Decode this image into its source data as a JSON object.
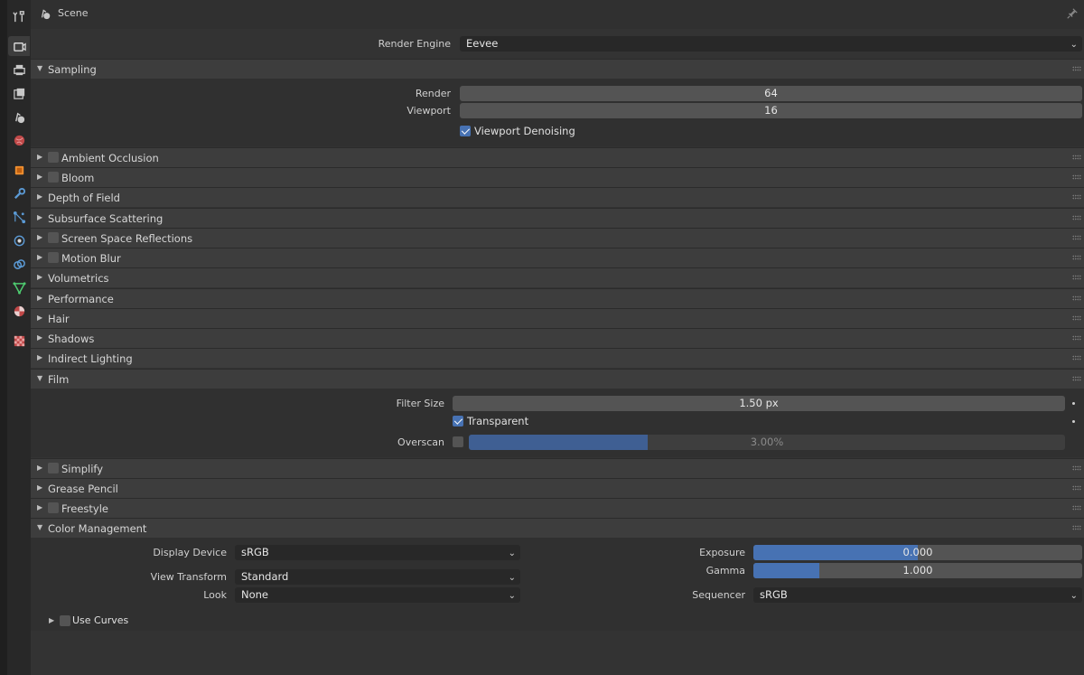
{
  "header": {
    "title": "Scene"
  },
  "tabs": [
    {
      "icon": "tool-icon",
      "color": "#c8c8c8"
    },
    {
      "icon": "render-icon",
      "color": "#c8c8c8",
      "active": true
    },
    {
      "icon": "output-icon",
      "color": "#c8c8c8"
    },
    {
      "icon": "view-layer-icon",
      "color": "#c8c8c8"
    },
    {
      "icon": "scene-icon",
      "color": "#c8c8c8"
    },
    {
      "icon": "world-icon",
      "color": "#e06060"
    },
    {
      "icon": "object-icon",
      "color": "#f09030"
    },
    {
      "icon": "modifier-icon",
      "color": "#5b9ad5"
    },
    {
      "icon": "particles-icon",
      "color": "#5b9ad5"
    },
    {
      "icon": "physics-icon",
      "color": "#5b9ad5"
    },
    {
      "icon": "constraints-icon",
      "color": "#5b9ad5"
    },
    {
      "icon": "data-icon",
      "color": "#4ecb70"
    },
    {
      "icon": "material-icon",
      "color": "#e06060"
    },
    {
      "icon": "texture-icon",
      "color": "#e06060"
    }
  ],
  "render_engine": {
    "label": "Render Engine",
    "value": "Eevee"
  },
  "sampling": {
    "title": "Sampling",
    "render_label": "Render",
    "render_value": "64",
    "viewport_label": "Viewport",
    "viewport_value": "16",
    "denoise_label": "Viewport Denoising"
  },
  "panels": {
    "ambient_occlusion": "Ambient Occlusion",
    "bloom": "Bloom",
    "depth_of_field": "Depth of Field",
    "subsurface": "Subsurface Scattering",
    "ssr": "Screen Space Reflections",
    "motion_blur": "Motion Blur",
    "volumetrics": "Volumetrics",
    "performance": "Performance",
    "hair": "Hair",
    "shadows": "Shadows",
    "indirect": "Indirect Lighting",
    "film": "Film",
    "simplify": "Simplify",
    "grease_pencil": "Grease Pencil",
    "freestyle": "Freestyle",
    "color_management": "Color Management"
  },
  "film": {
    "filter_label": "Filter Size",
    "filter_value": "1.50 px",
    "transparent_label": "Transparent",
    "overscan_label": "Overscan",
    "overscan_value": "3.00%",
    "overscan_fraction": 0.3
  },
  "color_management": {
    "display_device_label": "Display Device",
    "display_device_value": "sRGB",
    "view_transform_label": "View Transform",
    "view_transform_value": "Standard",
    "look_label": "Look",
    "look_value": "None",
    "exposure_label": "Exposure",
    "exposure_value": "0.000",
    "exposure_fraction": 0.5,
    "gamma_label": "Gamma",
    "gamma_value": "1.000",
    "gamma_fraction": 0.2,
    "sequencer_label": "Sequencer",
    "sequencer_value": "sRGB",
    "use_curves_label": "Use Curves"
  }
}
